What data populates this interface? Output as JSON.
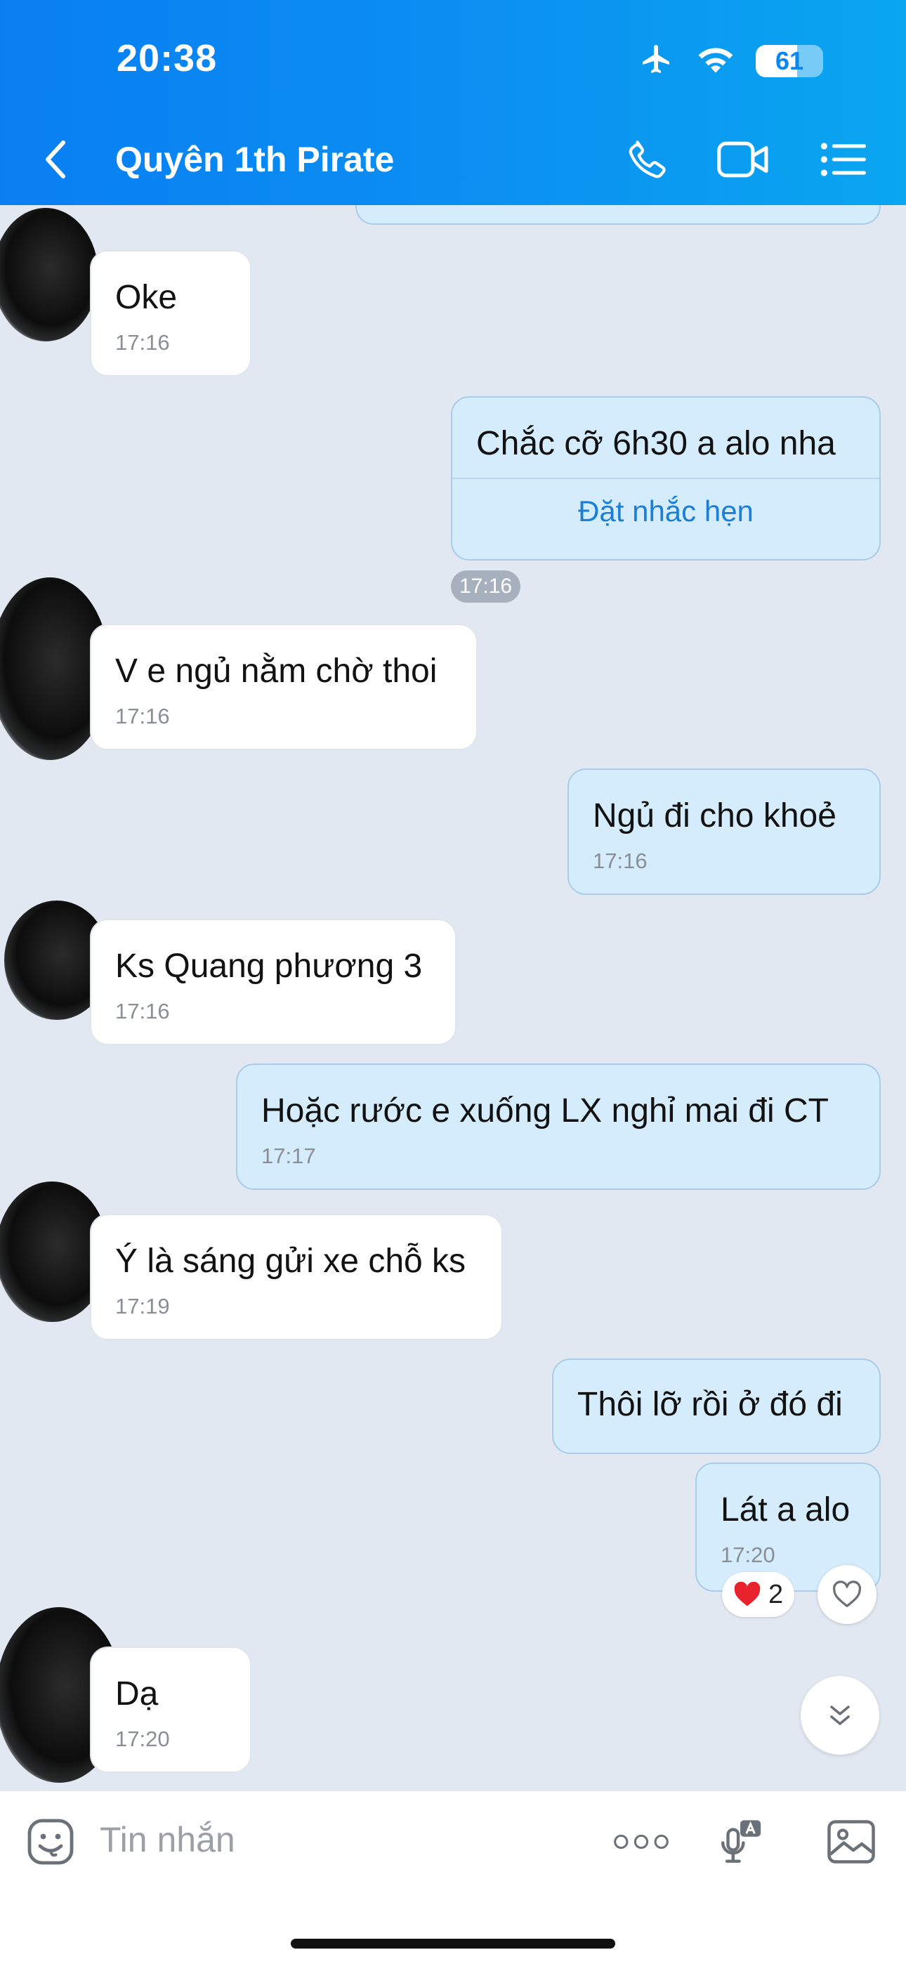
{
  "status_bar": {
    "time": "20:38",
    "battery": "61",
    "battery_level": 0.61
  },
  "header": {
    "contact_name": "Quyên 1th Pirate"
  },
  "messages": [
    {
      "dir": "in",
      "text": "Oke",
      "time": "17:16"
    },
    {
      "dir": "out",
      "text": "Chắc cỡ 6h30 a alo nha",
      "action": "Đặt nhắc hẹn",
      "time": "17:16"
    },
    {
      "dir": "in",
      "text": "V e ngủ nằm chờ thoi",
      "time": "17:16"
    },
    {
      "dir": "out",
      "text": "Ngủ đi cho khoẻ",
      "time": "17:16"
    },
    {
      "dir": "in",
      "text": "Ks Quang phương 3",
      "time": "17:16"
    },
    {
      "dir": "out",
      "text": "Hoặc rước e xuống LX nghỉ mai đi CT",
      "time": "17:17"
    },
    {
      "dir": "in",
      "text": "Ý là sáng gửi xe chỗ ks",
      "time": "17:19"
    },
    {
      "dir": "out",
      "text": "Thôi lỡ rồi ở đó đi"
    },
    {
      "dir": "out",
      "text": "Lát a alo",
      "time": "17:20",
      "reaction_count": "2"
    },
    {
      "dir": "in",
      "text": "Dạ",
      "time": "17:20"
    }
  ],
  "input": {
    "placeholder": "Tin nhắn"
  },
  "colors": {
    "header_start": "#0a7ff2",
    "header_end": "#0aa6f0",
    "outgoing_bubble": "#d5ecfc",
    "incoming_bubble": "#ffffff",
    "chat_bg": "#e2e8f1",
    "link": "#1c7fd6"
  },
  "icons": [
    "back-icon",
    "phone-icon",
    "video-call-icon",
    "menu-list-icon",
    "airplane-icon",
    "wifi-icon",
    "battery-icon",
    "sticker-icon",
    "more-icon",
    "voice-to-text-icon",
    "image-icon",
    "heart-icon",
    "scroll-down-icon"
  ]
}
